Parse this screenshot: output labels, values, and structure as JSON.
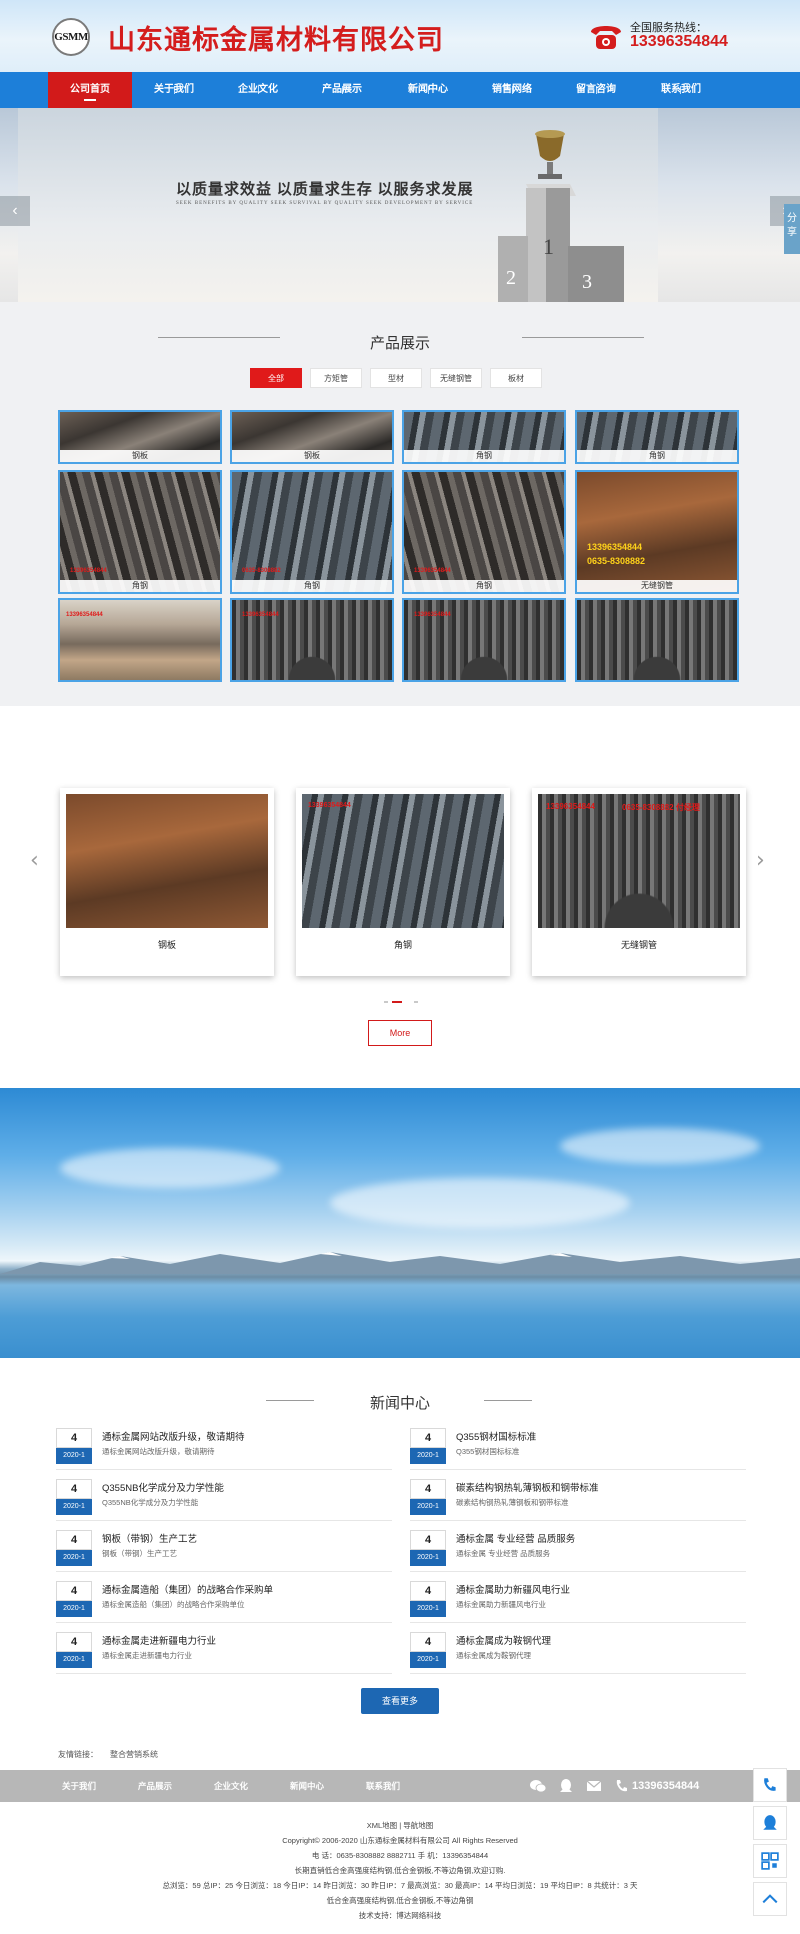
{
  "header": {
    "logo_text": "GSMM",
    "company_name": "山东通标金属材料有限公司",
    "hotline_label": "全国服务热线：",
    "hotline_number": "13396354844"
  },
  "nav": {
    "items": [
      "公司首页",
      "关于我们",
      "企业文化",
      "产品展示",
      "新闻中心",
      "销售网络",
      "留言咨询",
      "联系我们"
    ],
    "active_index": 0
  },
  "banner": {
    "slogan": "以质量求效益 以质量求生存 以服务求发展",
    "slogan_sub": "SEEK BENEFITS BY QUALITY SEEK SURVIVAL BY QUALITY SEEK DEVELOPMENT BY SERVICE",
    "podium_labels": [
      "1",
      "2",
      "3"
    ],
    "share_label": "分享",
    "prev_arrow": "‹",
    "next_arrow": "›"
  },
  "products": {
    "title": "产品展示",
    "tabs": [
      "全部",
      "方矩管",
      "型材",
      "无缝钢管",
      "板材"
    ],
    "active_tab": 0,
    "grid": [
      {
        "caption": "钢板",
        "texture": "steel-a"
      },
      {
        "caption": "钢板",
        "texture": "steel-a"
      },
      {
        "caption": "角钢",
        "texture": "steel-b"
      },
      {
        "caption": "角钢",
        "texture": "steel-b"
      },
      {
        "caption": "角钢",
        "texture": "steel-c"
      },
      {
        "caption": "角钢",
        "texture": "steel-b"
      },
      {
        "caption": "角钢",
        "texture": "steel-c"
      },
      {
        "caption": "无缝钢管",
        "texture": "steel-rust"
      },
      {
        "caption": "",
        "texture": "factory"
      },
      {
        "caption": "",
        "texture": "pipes"
      },
      {
        "caption": "",
        "texture": "pipes"
      },
      {
        "caption": "",
        "texture": "pipes"
      }
    ],
    "overlay_texts": [
      "13396354844",
      "0635-8308882"
    ]
  },
  "carousel": {
    "items": [
      {
        "caption": "钢板",
        "texture": "steel-rust"
      },
      {
        "caption": "角钢",
        "texture": "steel-b"
      },
      {
        "caption": "无缝钢管",
        "texture": "pipes"
      }
    ],
    "overlay_texts": [
      "13396354844",
      "0635-8308882 付经理"
    ],
    "prev_arrow": "‹",
    "next_arrow": "›",
    "more_label": "More"
  },
  "news": {
    "title": "新闻中心",
    "left": [
      {
        "day": "4",
        "ym": "2020-1",
        "title": "通标金属网站改版升级，敬请期待",
        "sub": "通标金属网站改版升级，敬请期待"
      },
      {
        "day": "4",
        "ym": "2020-1",
        "title": "Q355NB化学成分及力学性能",
        "sub": "Q355NB化学成分及力学性能"
      },
      {
        "day": "4",
        "ym": "2020-1",
        "title": "钢板（带钢）生产工艺",
        "sub": "钢板（带钢）生产工艺"
      },
      {
        "day": "4",
        "ym": "2020-1",
        "title": "通标金属造船（集团）的战略合作采购单",
        "sub": "通标金属造船（集团）的战略合作采购单位"
      },
      {
        "day": "4",
        "ym": "2020-1",
        "title": "通标金属走进新疆电力行业",
        "sub": "通标金属走进新疆电力行业"
      }
    ],
    "right": [
      {
        "day": "4",
        "ym": "2020-1",
        "title": "Q355钢材国标标准",
        "sub": "Q355钢材国标标准"
      },
      {
        "day": "4",
        "ym": "2020-1",
        "title": "碳素结构钢热轧薄钢板和钢带标准",
        "sub": "碳素结构钢热轧薄钢板和钢带标准"
      },
      {
        "day": "4",
        "ym": "2020-1",
        "title": "通标金属 专业经营 品质服务",
        "sub": "通标金属 专业经营 品质服务"
      },
      {
        "day": "4",
        "ym": "2020-1",
        "title": "通标金属助力新疆风电行业",
        "sub": "通标金属助力新疆风电行业"
      },
      {
        "day": "4",
        "ym": "2020-1",
        "title": "通标金属成为鞍钢代理",
        "sub": "通标金属成为鞍钢代理"
      }
    ],
    "view_more": "查看更多",
    "links_label": "友情链接：",
    "links": [
      "整合营销系统"
    ]
  },
  "footer_bar": {
    "nav": [
      "关于我们",
      "产品展示",
      "企业文化",
      "新闻中心",
      "联系我们"
    ],
    "phone": "13396354844"
  },
  "footer": {
    "sitemap": "XML地图 | 导航地图",
    "copyright": "Copyright© 2006-2020 山东通标金属材料有限公司 All Rights Reserved",
    "contact": "电 话：0635-8308882 8882711 手 机：13396354844",
    "line1": "长期直销低合金高强度结构钢,低合金钢板,不等边角钢,欢迎订购.",
    "stats": "总浏览：59 总IP：25 今日浏览：18 今日IP：14 昨日浏览：30 昨日IP：7 最高浏览：30 最高IP：14 平均日浏览：19 平均日IP：8 共统计：3 天",
    "line2": "低合金高强度结构钢,低合金钢板,不等边角钢",
    "support": "技术支持：博达网络科技"
  },
  "colors": {
    "brand_red": "#d41d1d",
    "nav_blue": "#1d7fd9",
    "news_blue": "#1d67b3"
  },
  "icons": [
    "phone-icon",
    "wechat-icon",
    "qq-icon",
    "mail-icon",
    "qrcode-icon",
    "back-to-top-icon"
  ]
}
